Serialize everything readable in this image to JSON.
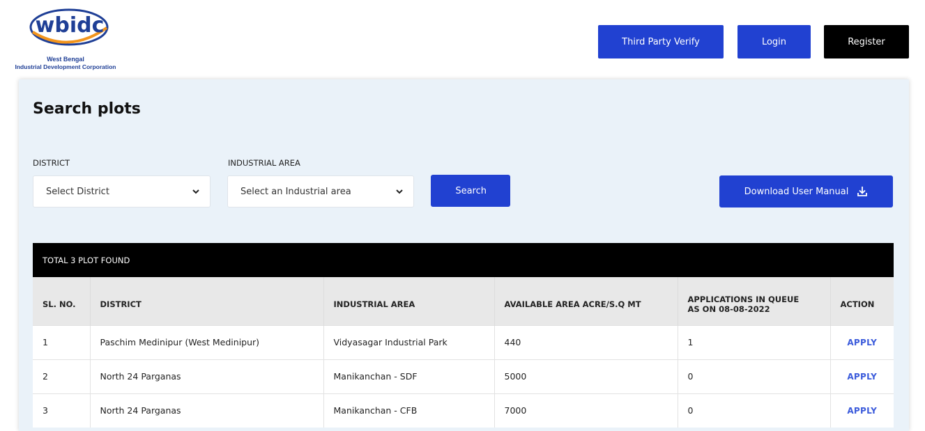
{
  "header": {
    "logo_text": "wbidc",
    "logo_sub1": "West Bengal",
    "logo_sub2": "Industrial Development Corporation",
    "buttons": {
      "third_party_verify": "Third Party Verify",
      "login": "Login",
      "register": "Register"
    }
  },
  "page": {
    "title": "Search plots"
  },
  "filters": {
    "district_label": "DISTRICT",
    "district_selected": "Select District",
    "area_label": "INDUSTRIAL AREA",
    "area_selected": "Select an Industrial area",
    "search_button": "Search",
    "download_button": "Download User Manual"
  },
  "results": {
    "summary": "TOTAL 3 PLOT FOUND",
    "columns": {
      "sl": "SL. NO.",
      "district": "DISTRICT",
      "area": "INDUSTRIAL AREA",
      "available": "AVAILABLE AREA ACRE/S.Q MT",
      "queue_line1": "APPLICATIONS IN QUEUE",
      "queue_line2": "AS ON 08-08-2022",
      "action": "ACTION"
    },
    "rows": [
      {
        "sl": "1",
        "district": "Paschim Medinipur (West Medinipur)",
        "area": "Vidyasagar Industrial Park",
        "available": "440",
        "queue": "1",
        "action": "APPLY"
      },
      {
        "sl": "2",
        "district": "North 24 Parganas",
        "area": "Manikanchan - SDF",
        "available": "5000",
        "queue": "0",
        "action": "APPLY"
      },
      {
        "sl": "3",
        "district": "North 24 Parganas",
        "area": "Manikanchan - CFB",
        "available": "7000",
        "queue": "0",
        "action": "APPLY"
      }
    ]
  },
  "colors": {
    "primary": "#2141d1",
    "dark": "#000000",
    "panel_bg": "#eaf2f9",
    "logo_blue": "#1f3f96",
    "logo_orange": "#f2941c",
    "link": "#3b5bdb"
  },
  "icons": {
    "select_arrow": "chevron-down-icon",
    "download": "download-icon"
  }
}
